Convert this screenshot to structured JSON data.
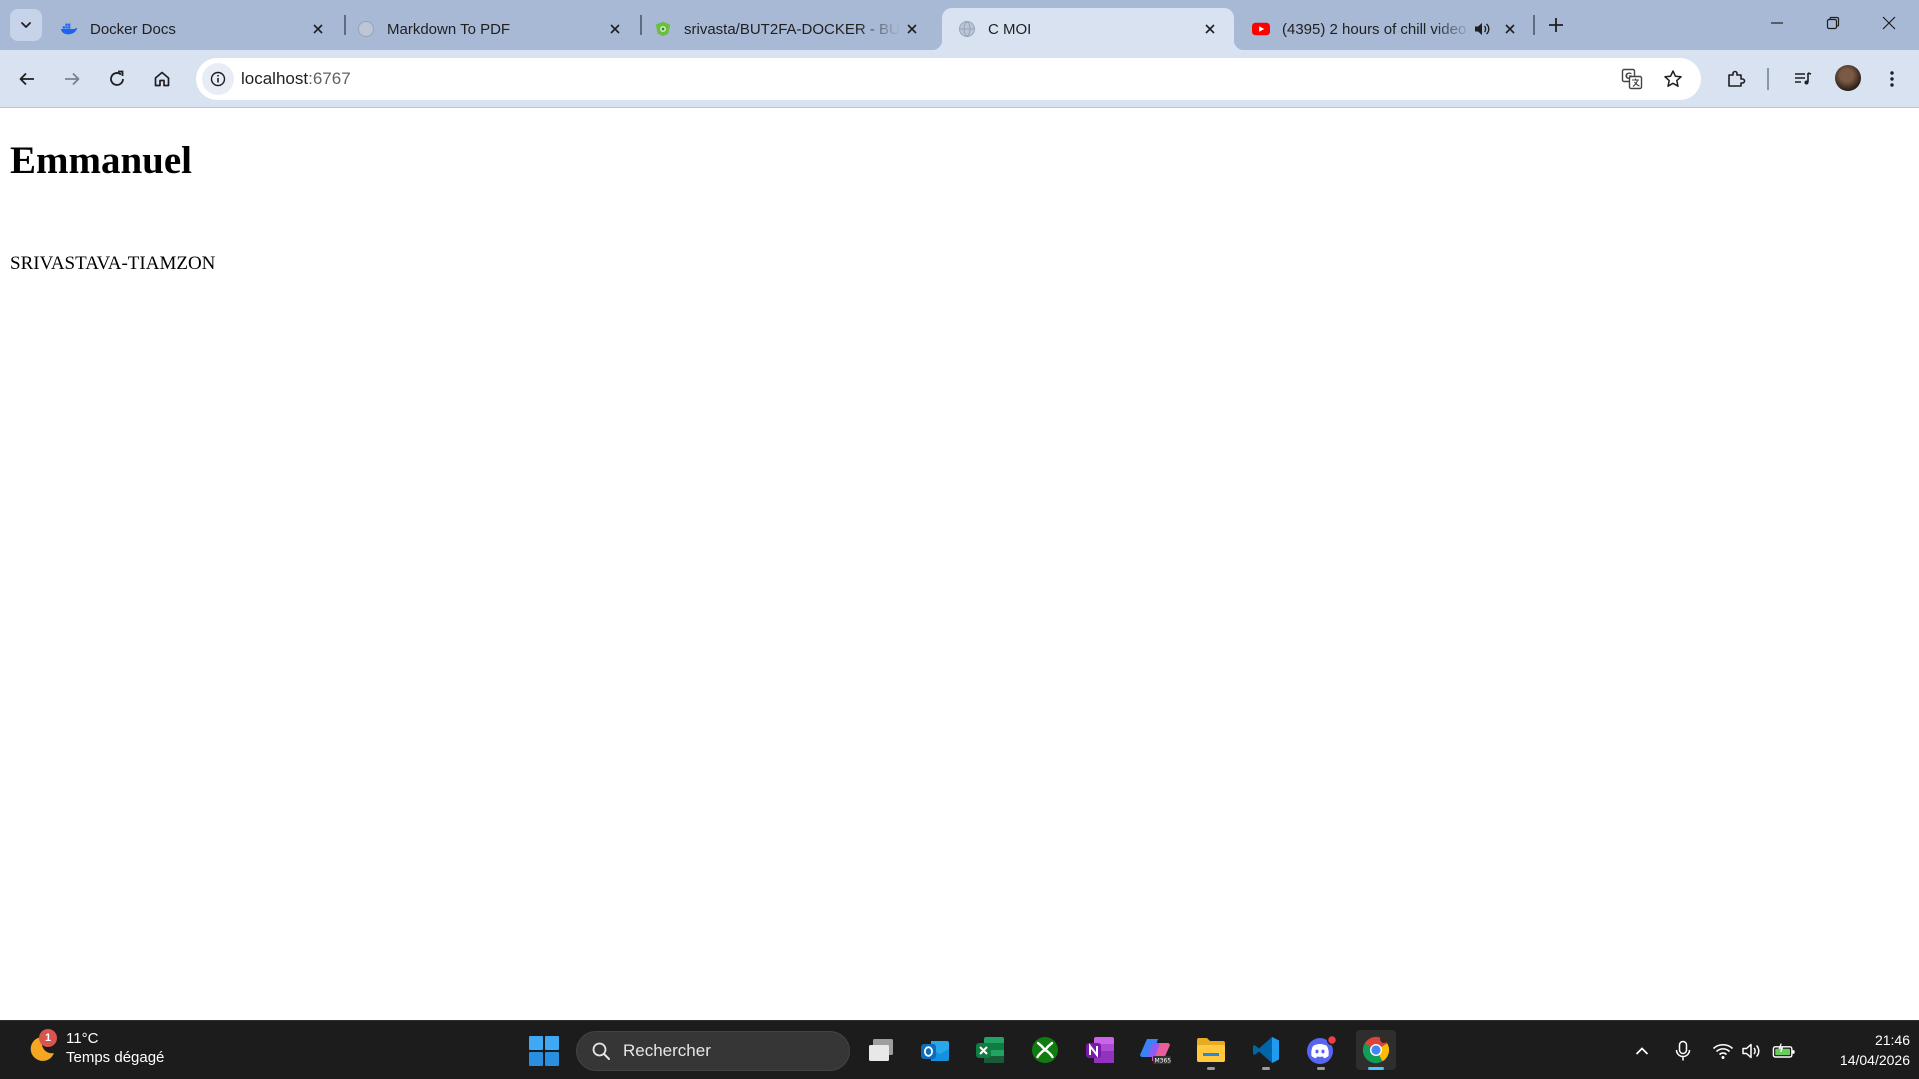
{
  "browser": {
    "tabs": [
      {
        "title": "Docker Docs",
        "favicon": "docker-icon",
        "active": false
      },
      {
        "title": "Markdown To PDF",
        "favicon": "globe-icon",
        "active": false
      },
      {
        "title": "srivasta/BUT2FA-DOCKER - BUT",
        "favicon": "hub-icon",
        "active": false
      },
      {
        "title": "C MOI",
        "favicon": "globe-icon",
        "active": true
      },
      {
        "title": "(4395) 2 hours of chill video",
        "favicon": "youtube-icon",
        "active": false,
        "audio": true
      }
    ],
    "address_bar": {
      "host": "localhost",
      "port": ":6767"
    },
    "accent_color": "#a8b9d6"
  },
  "page": {
    "heading": "Emmanuel",
    "paragraph": "SRIVASTAVA-TIAMZON"
  },
  "taskbar": {
    "weather": {
      "temperature": "11°C",
      "condition": "Temps dégagé",
      "badge": "1"
    },
    "search_placeholder": "Rechercher",
    "apps": [
      "task-view",
      "outlook",
      "excel",
      "xbox",
      "onenote",
      "m365-copilot",
      "file-explorer",
      "vscode",
      "discord",
      "chrome"
    ],
    "clock": {
      "time": "21:46",
      "date": "14/04/2026"
    }
  }
}
